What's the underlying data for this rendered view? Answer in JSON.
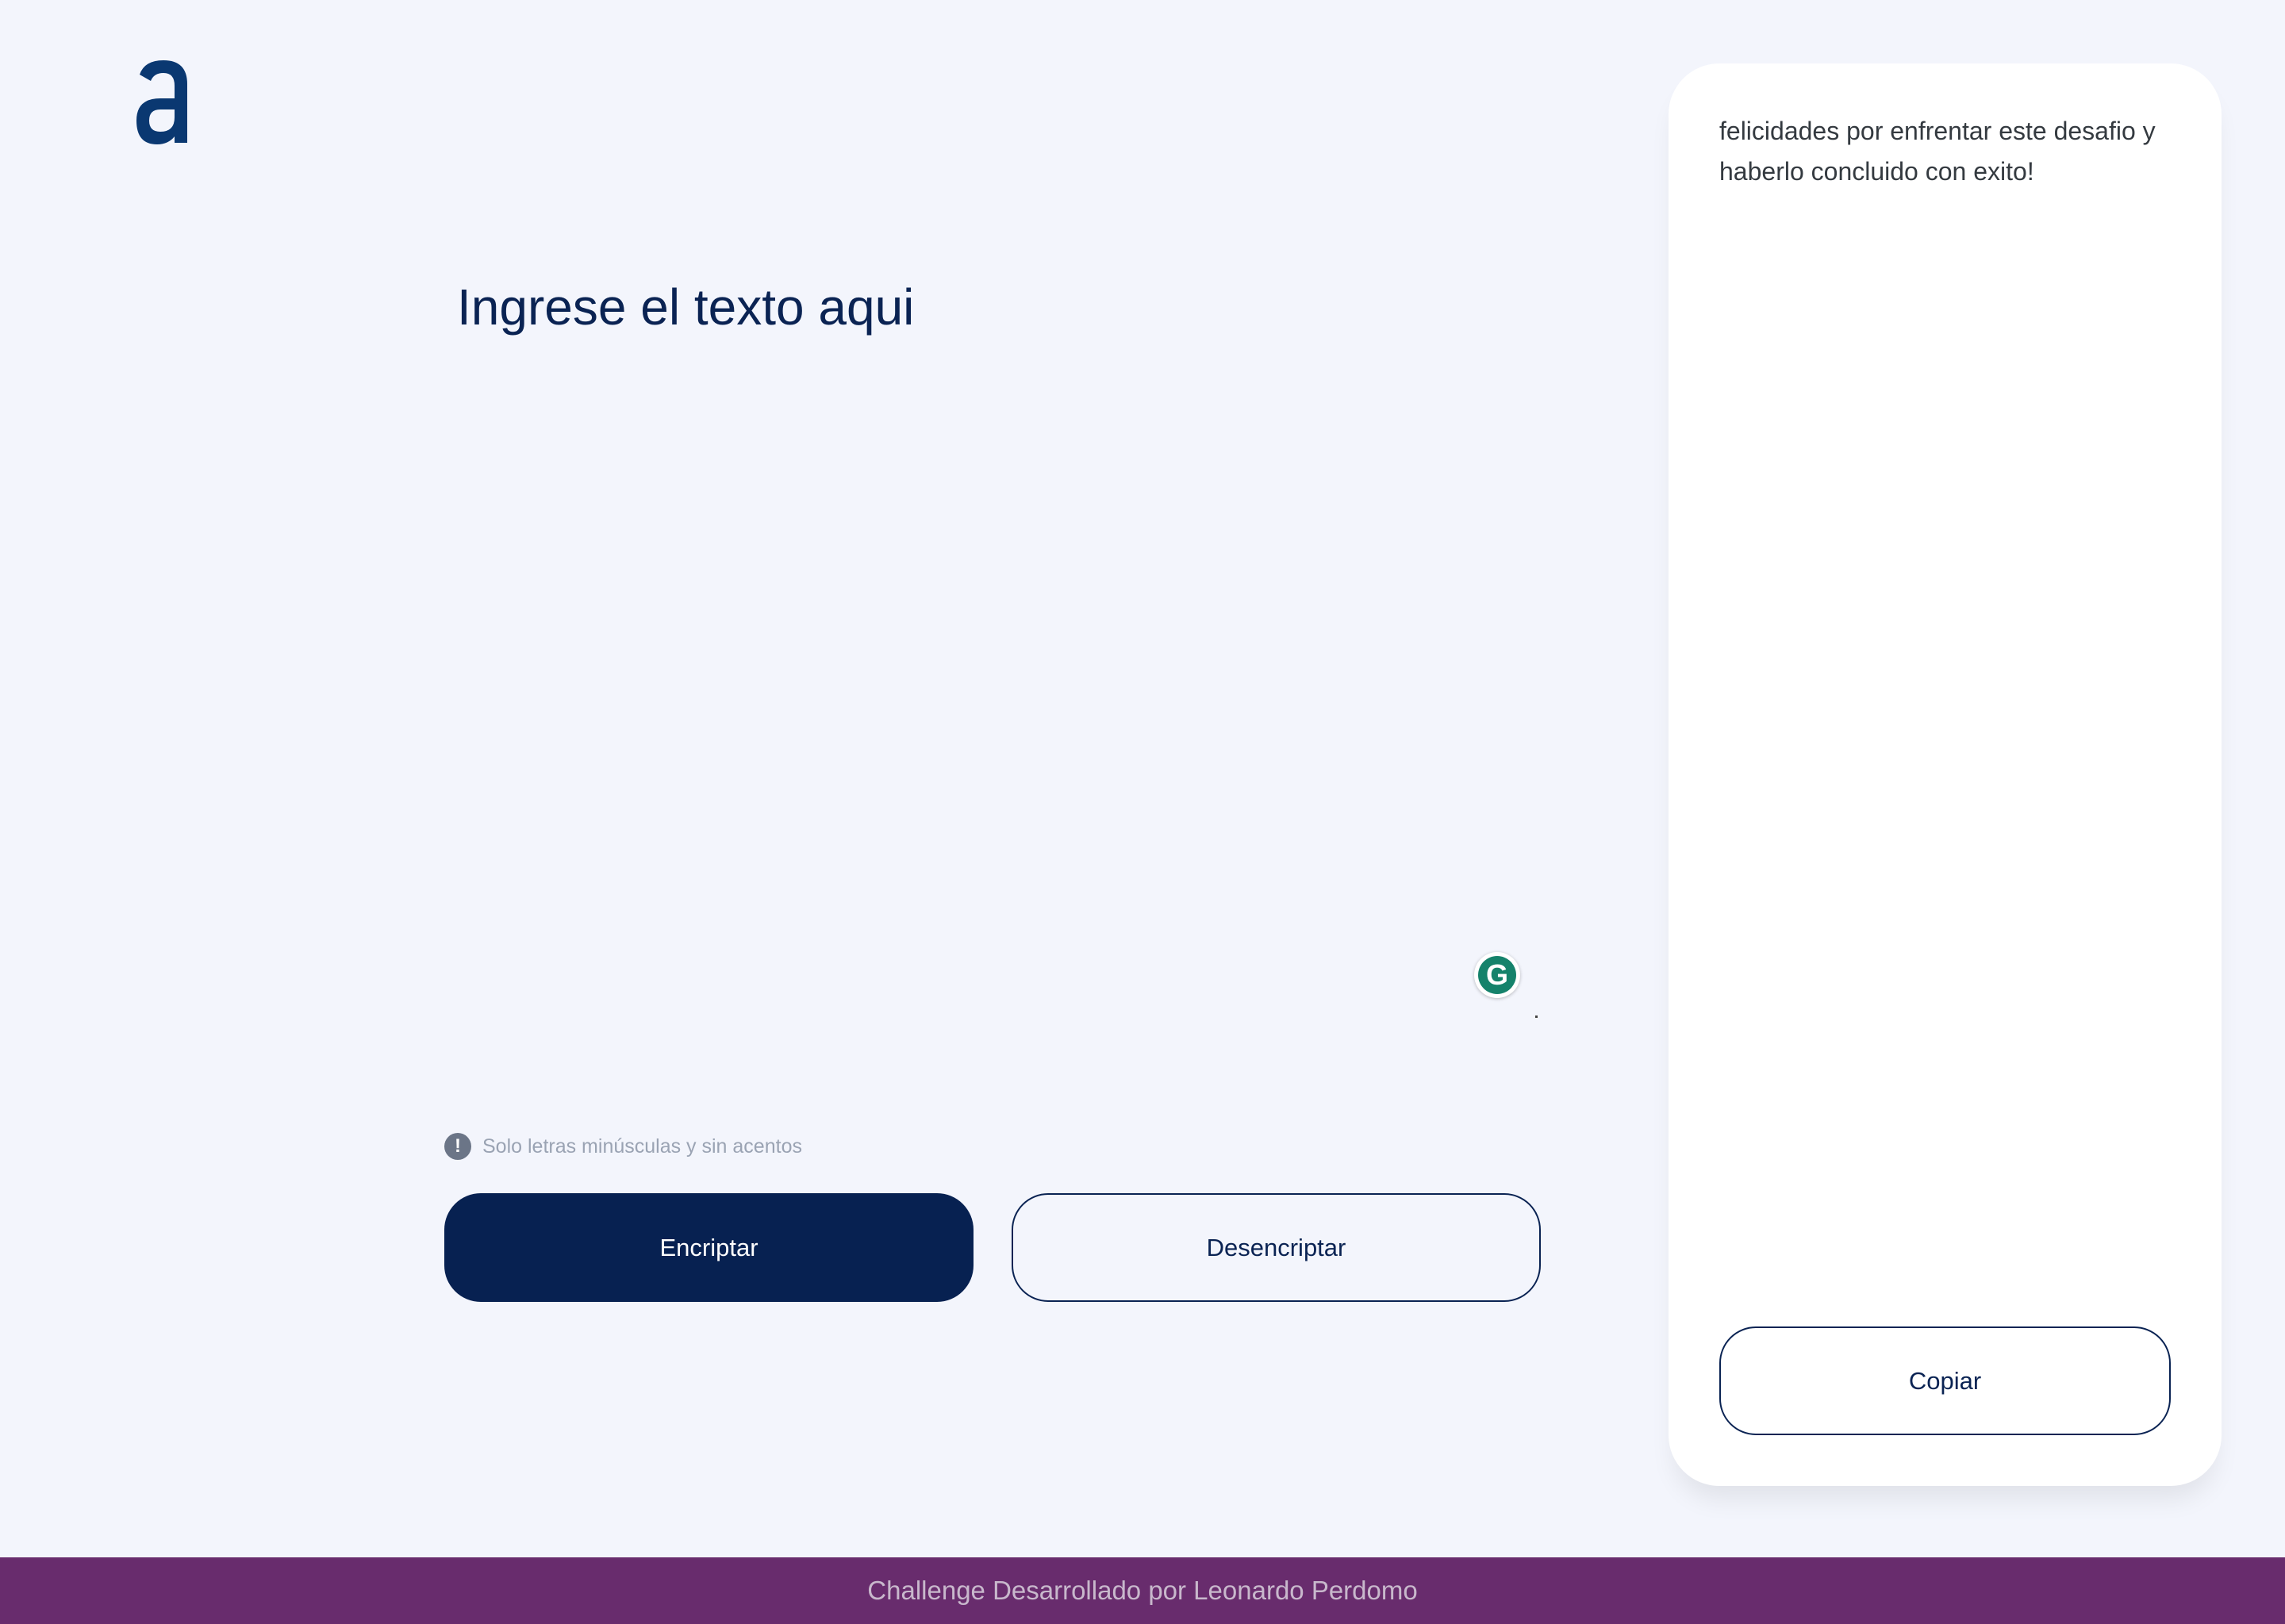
{
  "header": {
    "logo_icon": "alura-a-logo-icon"
  },
  "editor": {
    "placeholder": "Ingrese el texto aqui",
    "value": "",
    "grammarly_icon": "grammarly-icon",
    "grammarly_glyph": "G"
  },
  "hint": {
    "icon": "info-icon",
    "icon_glyph": "!",
    "text": "Solo letras minúsculas y sin acentos"
  },
  "actions": {
    "encrypt_label": "Encriptar",
    "decrypt_label": "Desencriptar"
  },
  "output_panel": {
    "text": "felicidades por enfrentar este desafio y haberlo concluido con exito!",
    "copy_label": "Copiar"
  },
  "footer": {
    "text": "Challenge Desarrollado por Leonardo Perdomo"
  },
  "colors": {
    "background": "#f3f5fc",
    "primary": "#072151",
    "footer": "#682c6d",
    "logo": "#0a3871",
    "grammarly": "#15826b"
  }
}
